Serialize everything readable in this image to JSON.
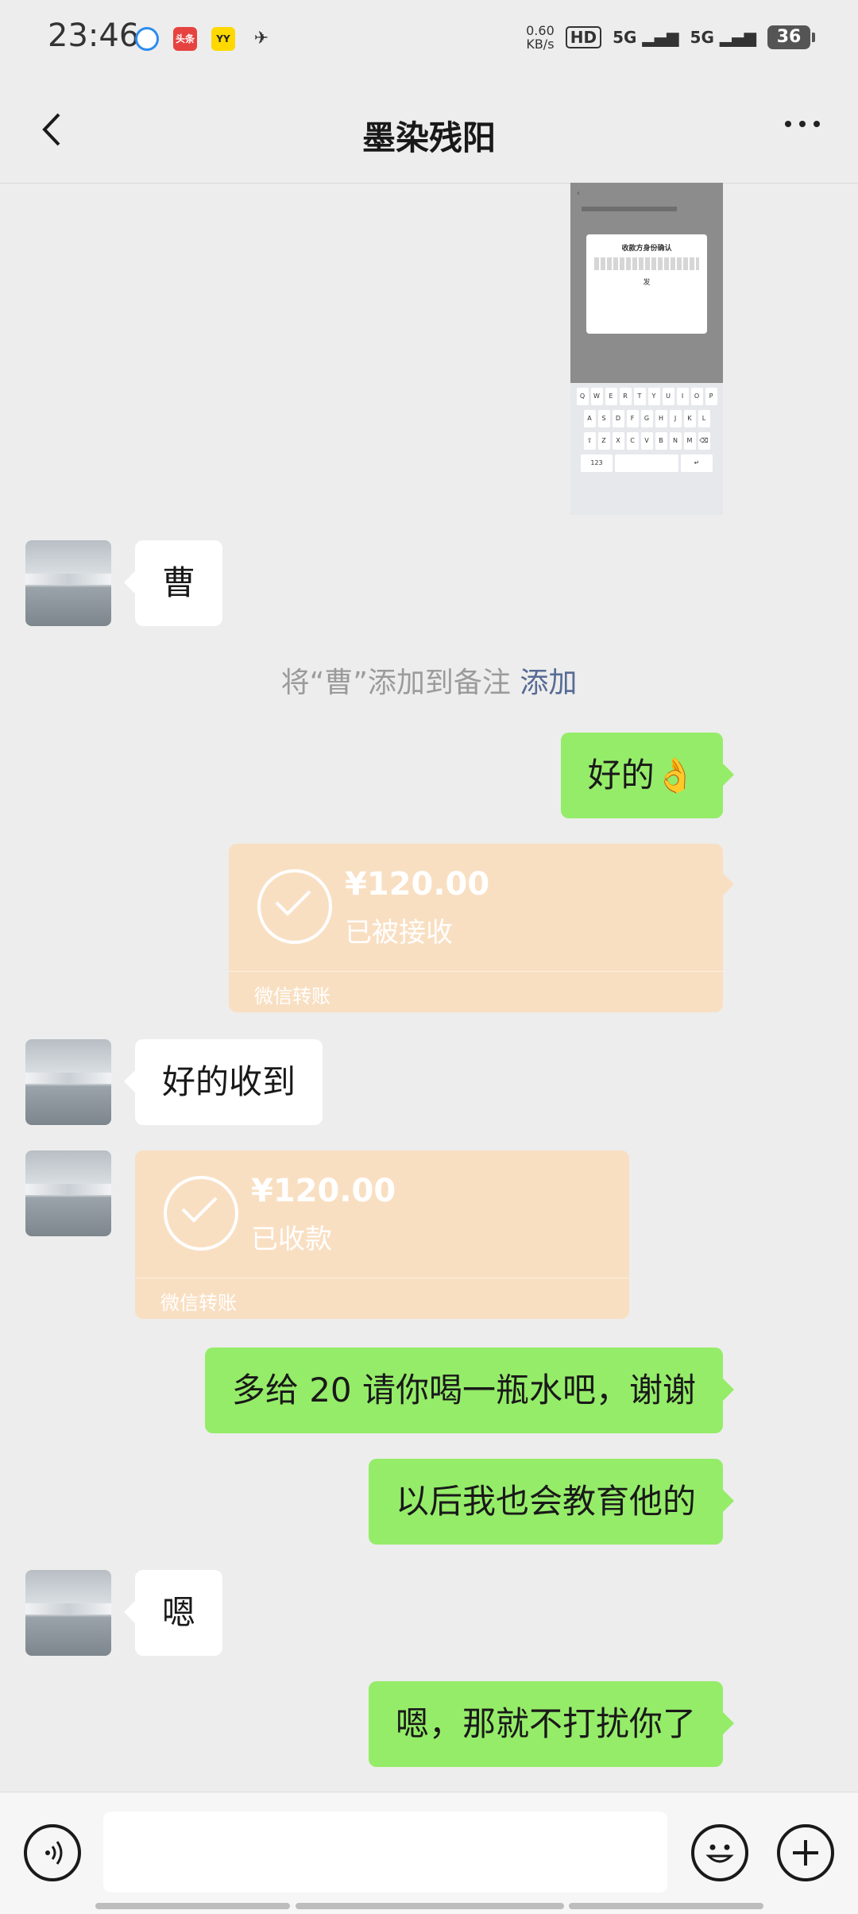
{
  "status_bar": {
    "time": "23:46",
    "app_icons": [
      "browser-icon",
      "toutiao-icon",
      "yy-icon",
      "plane-icon"
    ],
    "toutiao_label": "头条",
    "yy_label": "YY",
    "net_speed": "0.60",
    "net_unit": "KB/s",
    "hd_label": "HD",
    "signal1_label": "5G",
    "signal2_label": "5G",
    "battery": "36"
  },
  "nav": {
    "title": "墨染残阳"
  },
  "messages": [
    {
      "side": "out",
      "type": "image",
      "thumb": {
        "dialog_title": "收款方身份确认",
        "dialog_text": "发"
      }
    },
    {
      "side": "in",
      "type": "text",
      "text": "曹"
    },
    {
      "side": "system",
      "type": "note",
      "text": "将“曹”添加到备注",
      "action": "添加"
    },
    {
      "side": "out",
      "type": "text",
      "text": "好的👌"
    },
    {
      "side": "out",
      "type": "transfer",
      "amount": "¥120.00",
      "status": "已被接收",
      "footer": "微信转账"
    },
    {
      "side": "in",
      "type": "text",
      "text": "好的收到"
    },
    {
      "side": "in",
      "type": "transfer",
      "amount": "¥120.00",
      "status": "已收款",
      "footer": "微信转账"
    },
    {
      "side": "out",
      "type": "text",
      "text": "多给 20 请你喝一瓶水吧，谢谢"
    },
    {
      "side": "out",
      "type": "text",
      "text": "以后我也会教育他的"
    },
    {
      "side": "in",
      "type": "text",
      "text": "嗯"
    },
    {
      "side": "out",
      "type": "text",
      "text": "嗯，那就不打扰你了"
    }
  ],
  "colors": {
    "background": "#ededed",
    "out_bubble": "#95ec69",
    "in_bubble": "#ffffff",
    "transfer": "#f9dfc2",
    "link": "#576b95"
  },
  "input_bar": {
    "icons": [
      "voice-icon",
      "emoji-icon",
      "plus-icon"
    ]
  }
}
